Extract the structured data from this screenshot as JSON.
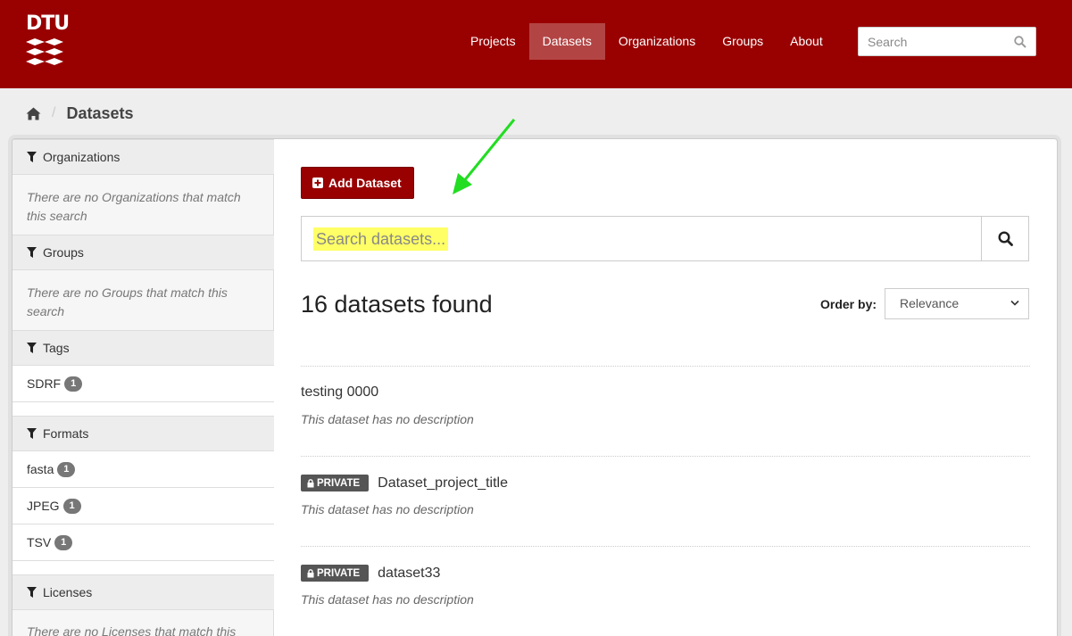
{
  "header": {
    "logo_text": "DTU",
    "nav": [
      {
        "label": "Projects",
        "active": false
      },
      {
        "label": "Datasets",
        "active": true
      },
      {
        "label": "Organizations",
        "active": false
      },
      {
        "label": "Groups",
        "active": false
      },
      {
        "label": "About",
        "active": false
      }
    ],
    "search_placeholder": "Search"
  },
  "breadcrumb": {
    "home_icon": "home-icon",
    "current": "Datasets"
  },
  "sidebar": {
    "organizations": {
      "title": "Organizations",
      "empty": "There are no Organizations that match this search"
    },
    "groups": {
      "title": "Groups",
      "empty": "There are no Groups that match this search"
    },
    "tags": {
      "title": "Tags",
      "items": [
        {
          "label": "SDRF",
          "count": "1"
        }
      ]
    },
    "formats": {
      "title": "Formats",
      "items": [
        {
          "label": "fasta",
          "count": "1"
        },
        {
          "label": "JPEG",
          "count": "1"
        },
        {
          "label": "TSV",
          "count": "1"
        }
      ]
    },
    "licenses": {
      "title": "Licenses",
      "empty": "There are no Licenses that match this search"
    }
  },
  "main": {
    "add_button": "Add Dataset",
    "search_placeholder": "Search datasets...",
    "count_text": "16 datasets found",
    "order_label": "Order by:",
    "order_value": "Relevance",
    "datasets": [
      {
        "title": "testing 0000",
        "private": false,
        "description": "This dataset has no description"
      },
      {
        "title": "Dataset_project_title",
        "private": true,
        "badge": "PRIVATE",
        "description": "This dataset has no description"
      },
      {
        "title": "dataset33",
        "private": true,
        "badge": "PRIVATE",
        "description": "This dataset has no description"
      }
    ]
  },
  "colors": {
    "brand": "#990000",
    "active_nav": "#b34444",
    "highlight": "#ffff66",
    "arrow": "#22dd22"
  }
}
